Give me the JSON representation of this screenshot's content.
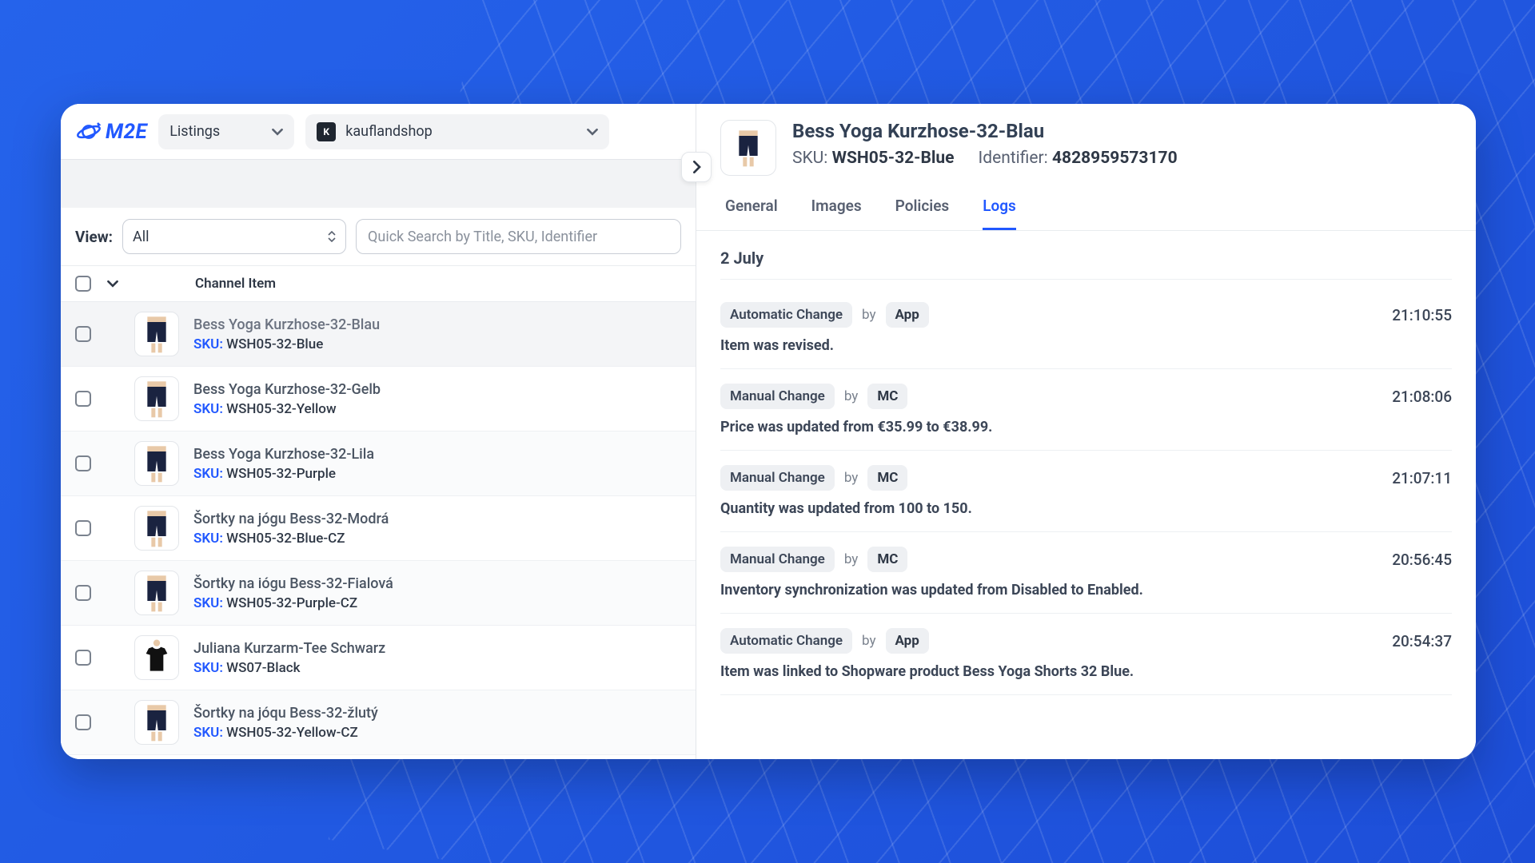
{
  "brand": "M2E",
  "topbar": {
    "listings_label": "Listings",
    "shop_label": "kauflandshop"
  },
  "filters": {
    "view_label": "View:",
    "view_value": "All",
    "search_placeholder": "Quick Search by Title, SKU, Identifier"
  },
  "table": {
    "header_channel_item": "Channel Item",
    "sku_prefix": "SKU:",
    "rows": [
      {
        "title": "Bess Yoga Kurzhose-32-Blau",
        "sku": "WSH05-32-Blue",
        "selected": true,
        "thumb": "shorts"
      },
      {
        "title": "Bess Yoga Kurzhose-32-Gelb",
        "sku": "WSH05-32-Yellow",
        "thumb": "shorts"
      },
      {
        "title": "Bess Yoga Kurzhose-32-Lila",
        "sku": "WSH05-32-Purple",
        "alt": true,
        "thumb": "shorts"
      },
      {
        "title": "Šortky na jógu Bess-32-Modrá",
        "sku": "WSH05-32-Blue-CZ",
        "thumb": "shorts"
      },
      {
        "title": "Šortky na iógu Bess-32-Fialová",
        "sku": "WSH05-32-Purple-CZ",
        "alt": true,
        "thumb": "shorts"
      },
      {
        "title": "Juliana Kurzarm-Tee Schwarz",
        "sku": "WS07-Black",
        "thumb": "tee"
      },
      {
        "title": "Šortky na jóqu Bess-32-žlutý",
        "sku": "WSH05-32-Yellow-CZ",
        "alt": true,
        "thumb": "shorts"
      }
    ]
  },
  "detail": {
    "title": "Bess Yoga Kurzhose-32-Blau",
    "sku_label": "SKU:",
    "sku_value": "WSH05-32-Blue",
    "identifier_label": "Identifier:",
    "identifier_value": "4828959573170",
    "tabs": {
      "general": "General",
      "images": "Images",
      "policies": "Policies",
      "logs": "Logs"
    },
    "logs_date": "2 July",
    "by_label": "by",
    "entries": [
      {
        "type": "Automatic Change",
        "actor": "App",
        "time": "21:10:55",
        "msg": "Item was revised."
      },
      {
        "type": "Manual Change",
        "actor": "MC",
        "time": "21:08:06",
        "msg": "Price was updated from €35.99 to €38.99."
      },
      {
        "type": "Manual Change",
        "actor": "MC",
        "time": "21:07:11",
        "msg": "Quantity was updated from 100 to 150."
      },
      {
        "type": "Manual Change",
        "actor": "MC",
        "time": "20:56:45",
        "msg": "Inventory synchronization was updated from Disabled to Enabled."
      },
      {
        "type": "Automatic Change",
        "actor": "App",
        "time": "20:54:37",
        "msg": "Item was linked to Shopware product Bess Yoga Shorts 32 Blue."
      }
    ]
  }
}
